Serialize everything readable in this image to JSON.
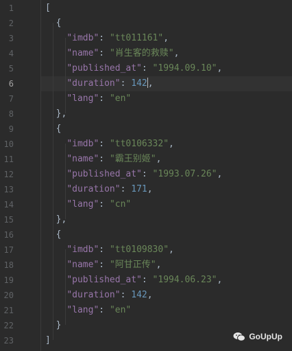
{
  "editor": {
    "line_numbers": [
      "1",
      "2",
      "3",
      "4",
      "5",
      "6",
      "7",
      "8",
      "9",
      "10",
      "11",
      "12",
      "13",
      "14",
      "15",
      "16",
      "17",
      "18",
      "19",
      "20",
      "21",
      "22",
      "23"
    ],
    "active_line": "6",
    "lines": [
      "[",
      "  {",
      "    \"imdb\": \"tt011161\",",
      "    \"name\": \"肖生客的救赎\",",
      "    \"published_at\": \"1994.09.10\",",
      "    \"duration\": 142,",
      "    \"lang\": \"en\"",
      "  },",
      "  {",
      "    \"imdb\": \"tt0106332\",",
      "    \"name\": \"霸王别姬\",",
      "    \"published_at\": \"1993.07.26\",",
      "    \"duration\": 171,",
      "    \"lang\": \"cn\"",
      "  },",
      "  {",
      "    \"imdb\": \"tt0109830\",",
      "    \"name\": \"阿甘正传\",",
      "    \"published_at\": \"1994.06.23\",",
      "    \"duration\": 142,",
      "    \"lang\": \"en\"",
      "  }",
      "]"
    ]
  },
  "watermark": {
    "text": "GoUpUp",
    "icon": "wechat-icon"
  },
  "colors": {
    "background": "#2b2b2b",
    "key": "#9876aa",
    "string": "#6a8759",
    "number": "#6897bb",
    "punctuation": "#a9b7c6",
    "line_number": "#606366"
  }
}
